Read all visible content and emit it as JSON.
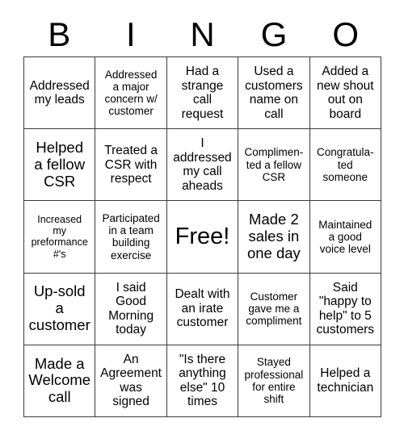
{
  "card": {
    "title_letters": [
      "B",
      "I",
      "N",
      "G",
      "O"
    ],
    "columns": 5,
    "rows": 5,
    "border_color": "#3a3a3a",
    "background_color": "#ffffff",
    "text_color": "#000000",
    "cells": [
      {
        "text": "Addressed\nmy leads",
        "size": "md"
      },
      {
        "text": "Addressed\na major\nconcern w/\ncustomer",
        "size": "sm"
      },
      {
        "text": "Had a\nstrange\ncall\nrequest",
        "size": "md"
      },
      {
        "text": "Used a\ncustomers\nname on\ncall",
        "size": "md"
      },
      {
        "text": "Added a\nnew shout\nout on\nboard",
        "size": "md"
      },
      {
        "text": "Helped\na fellow\nCSR",
        "size": "lg"
      },
      {
        "text": "Treated a\nCSR with\nrespect",
        "size": "md"
      },
      {
        "text": "I\naddressed\nmy call\naheads",
        "size": "md"
      },
      {
        "text": "Complimen-\nted a fellow\nCSR",
        "size": "sm"
      },
      {
        "text": "Congratula-\nted\nsomeone",
        "size": "sm"
      },
      {
        "text": "Increased\nmy\npreformance\n#'s",
        "size": "xs"
      },
      {
        "text": "Participated\nin a team\nbuilding\nexercise",
        "size": "sm"
      },
      {
        "text": "Free!",
        "size": "xl"
      },
      {
        "text": "Made 2\nsales in\none day",
        "size": "lg"
      },
      {
        "text": "Maintained\na good\nvoice level",
        "size": "sm"
      },
      {
        "text": "Up-sold\na\ncustomer",
        "size": "lg"
      },
      {
        "text": "I said\nGood\nMorning\ntoday",
        "size": "md"
      },
      {
        "text": "Dealt with\nan irate\ncustomer",
        "size": "md"
      },
      {
        "text": "Customer\ngave me a\ncompliment",
        "size": "sm"
      },
      {
        "text": "Said\n\"happy to\nhelp\" to 5\ncustomers",
        "size": "md"
      },
      {
        "text": "Made a\nWelcome\ncall",
        "size": "lg"
      },
      {
        "text": "An\nAgreement\nwas\nsigned",
        "size": "md"
      },
      {
        "text": "\"Is there\nanything\nelse\" 10\ntimes",
        "size": "md"
      },
      {
        "text": "Stayed\nprofessional\nfor entire\nshift",
        "size": "sm"
      },
      {
        "text": "Helped a\ntechnician",
        "size": "md"
      }
    ]
  }
}
